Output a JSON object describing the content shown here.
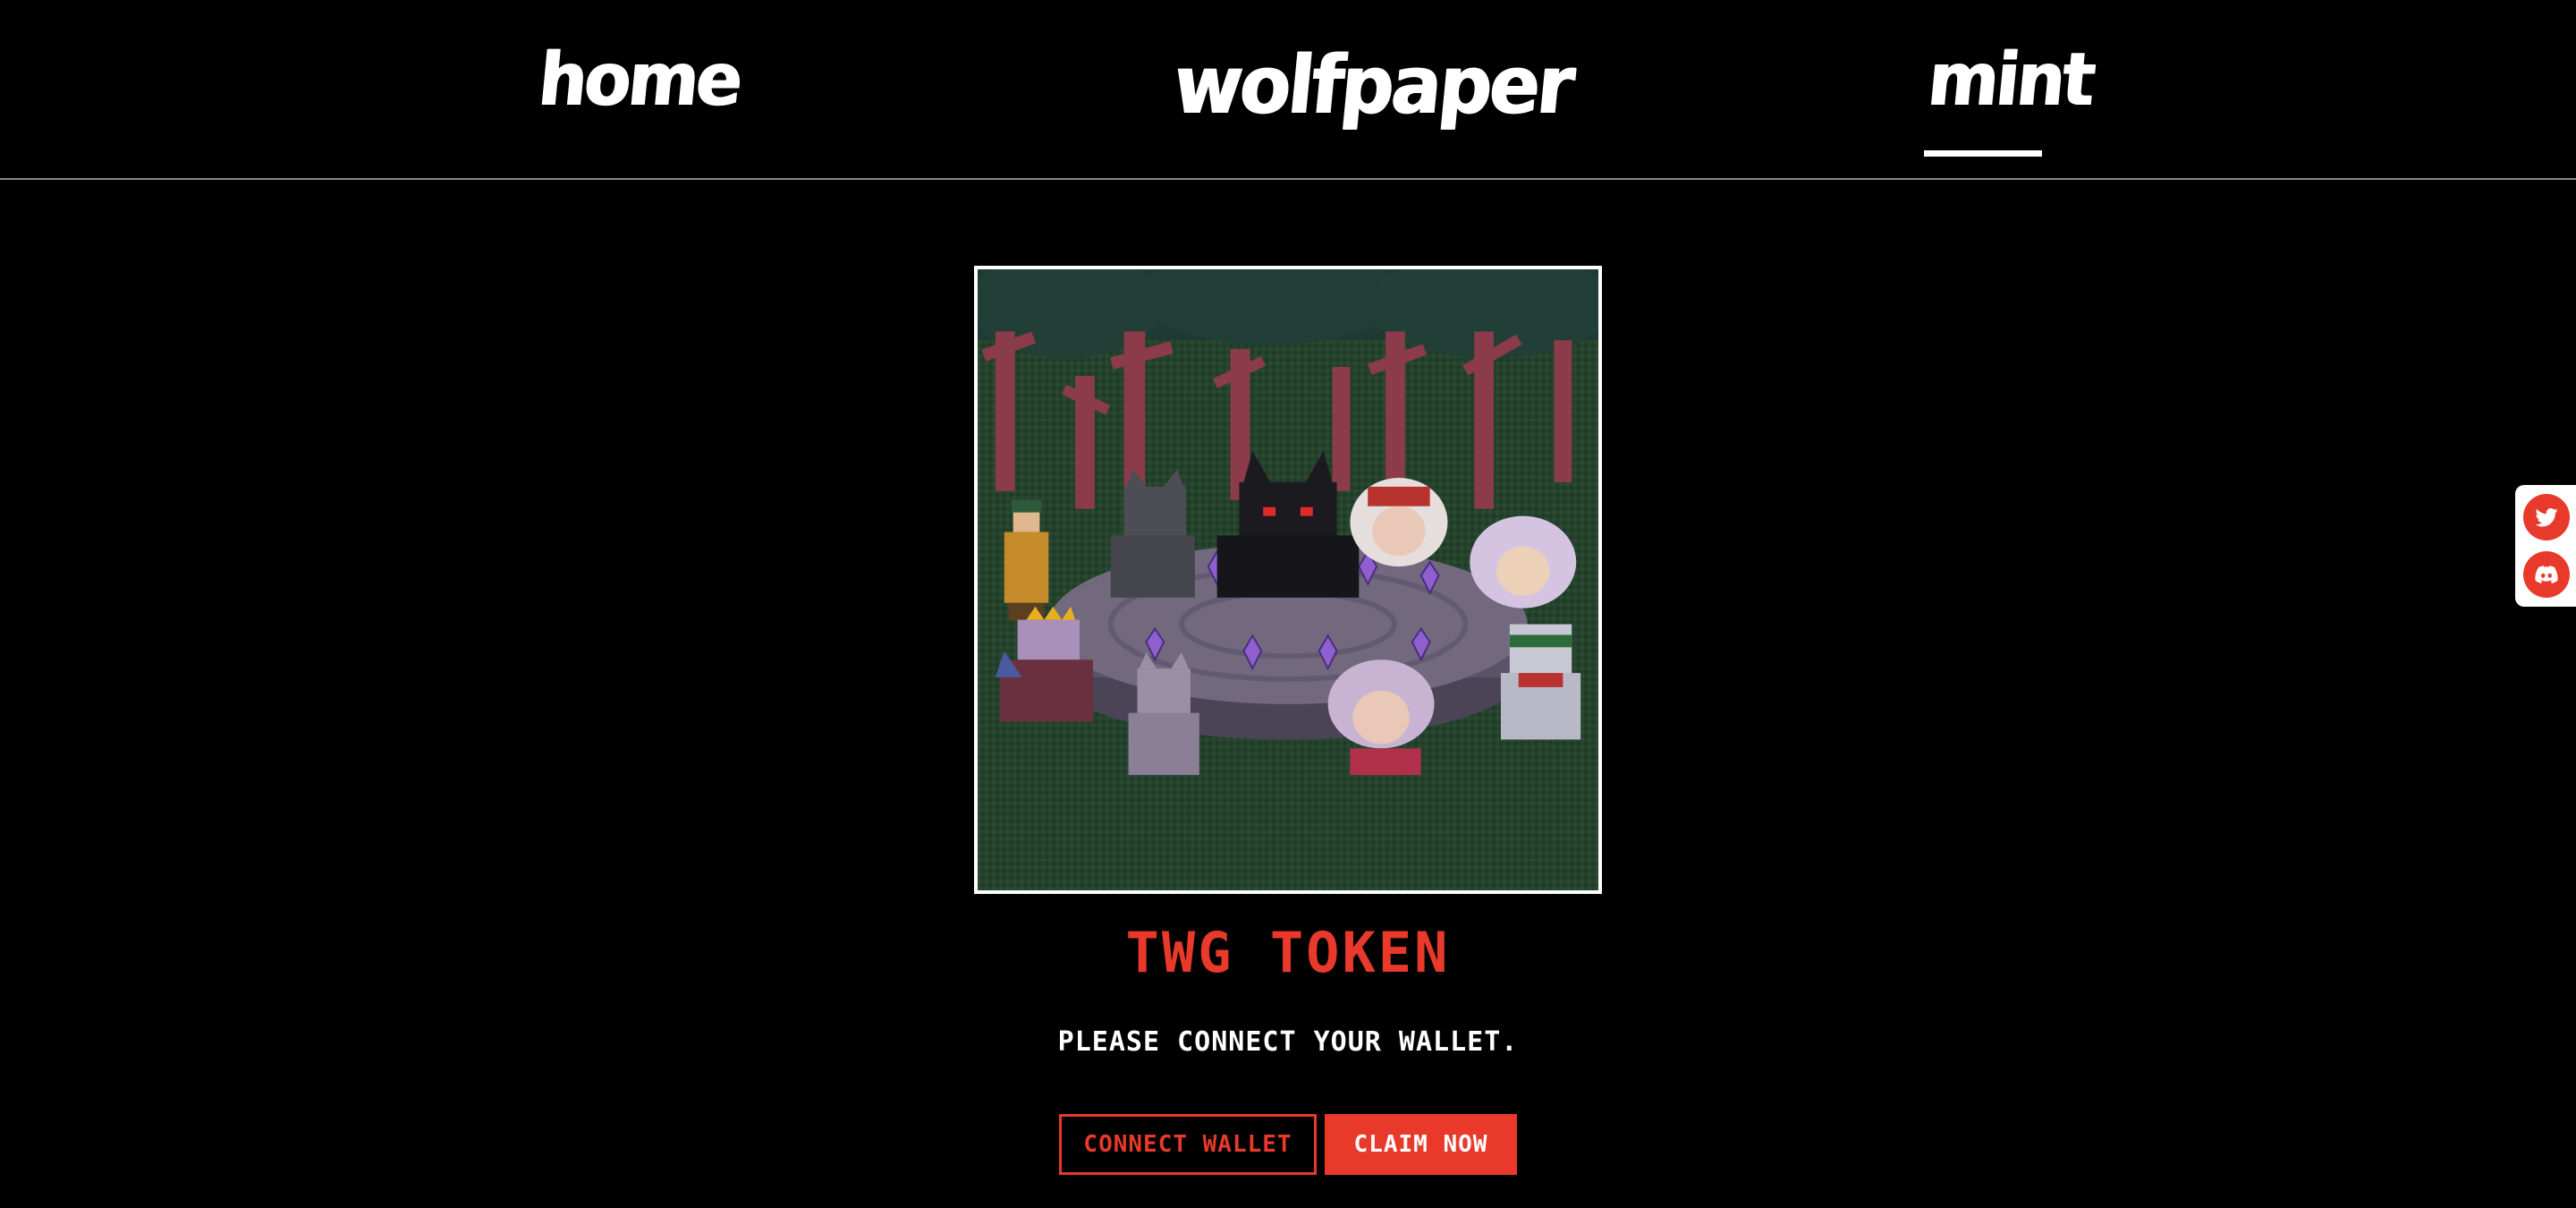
{
  "nav": {
    "home_label": "home",
    "brand_label": "wolfpaper",
    "mint_label": "mint",
    "active": "mint"
  },
  "artwork": {
    "alt": "TWG TOKEN"
  },
  "token": {
    "title": "TWG TOKEN",
    "status": "PLEASE CONNECT YOUR WALLET."
  },
  "buttons": {
    "connect_label": "CONNECT WALLET",
    "claim_label": "CLAIM NOW"
  },
  "social": {
    "twitter_icon": "twitter-icon",
    "discord_icon": "discord-icon"
  },
  "colors": {
    "accent": "#e8392a",
    "background": "#000000",
    "text": "#ffffff"
  }
}
